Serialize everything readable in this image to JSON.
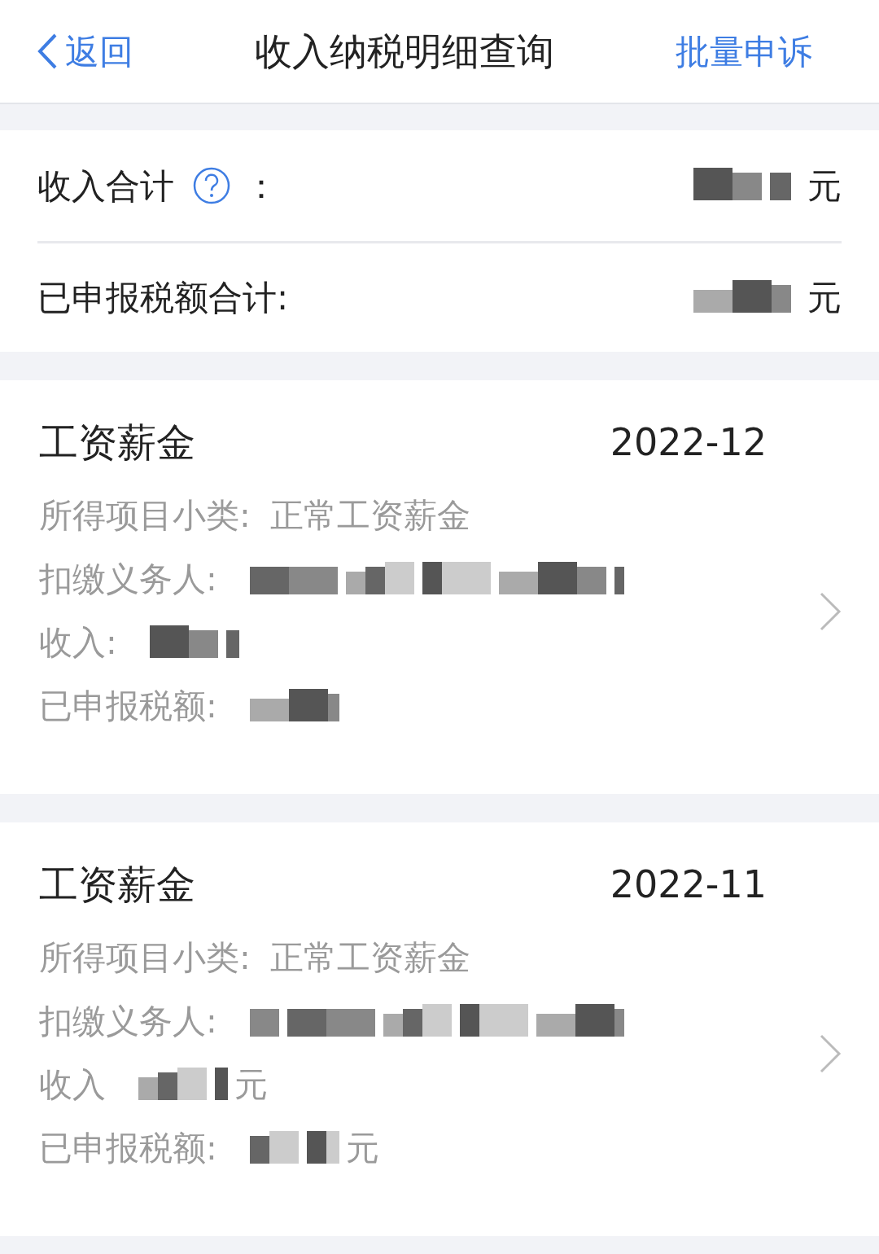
{
  "nav": {
    "back": "返回",
    "title": "收入纳税明细查询",
    "action": "批量申诉"
  },
  "summary": [
    {
      "label": "收入合计",
      "help": true,
      "colon": "：",
      "suffix": "元"
    },
    {
      "label": "已申报税额合计:",
      "help": false,
      "suffix": "元"
    }
  ],
  "records": [
    {
      "category": "工资薪金",
      "period": "2022-12",
      "fields": [
        {
          "label": "所得项目小类:",
          "value": "正常工资薪金"
        },
        {
          "label": "扣缴义务人:",
          "redacted": true
        },
        {
          "label": "收入:",
          "redacted": true
        },
        {
          "label": "已申报税额:",
          "redacted": true
        }
      ]
    },
    {
      "category": "工资薪金",
      "period": "2022-11",
      "fields": [
        {
          "label": "所得项目小类:",
          "value": "正常工资薪金"
        },
        {
          "label": "扣缴义务人:",
          "redacted": true
        },
        {
          "label": "收入",
          "redacted": true,
          "suffix": "元"
        },
        {
          "label": "已申报税额:",
          "redacted": true,
          "suffix": "元"
        }
      ]
    }
  ]
}
